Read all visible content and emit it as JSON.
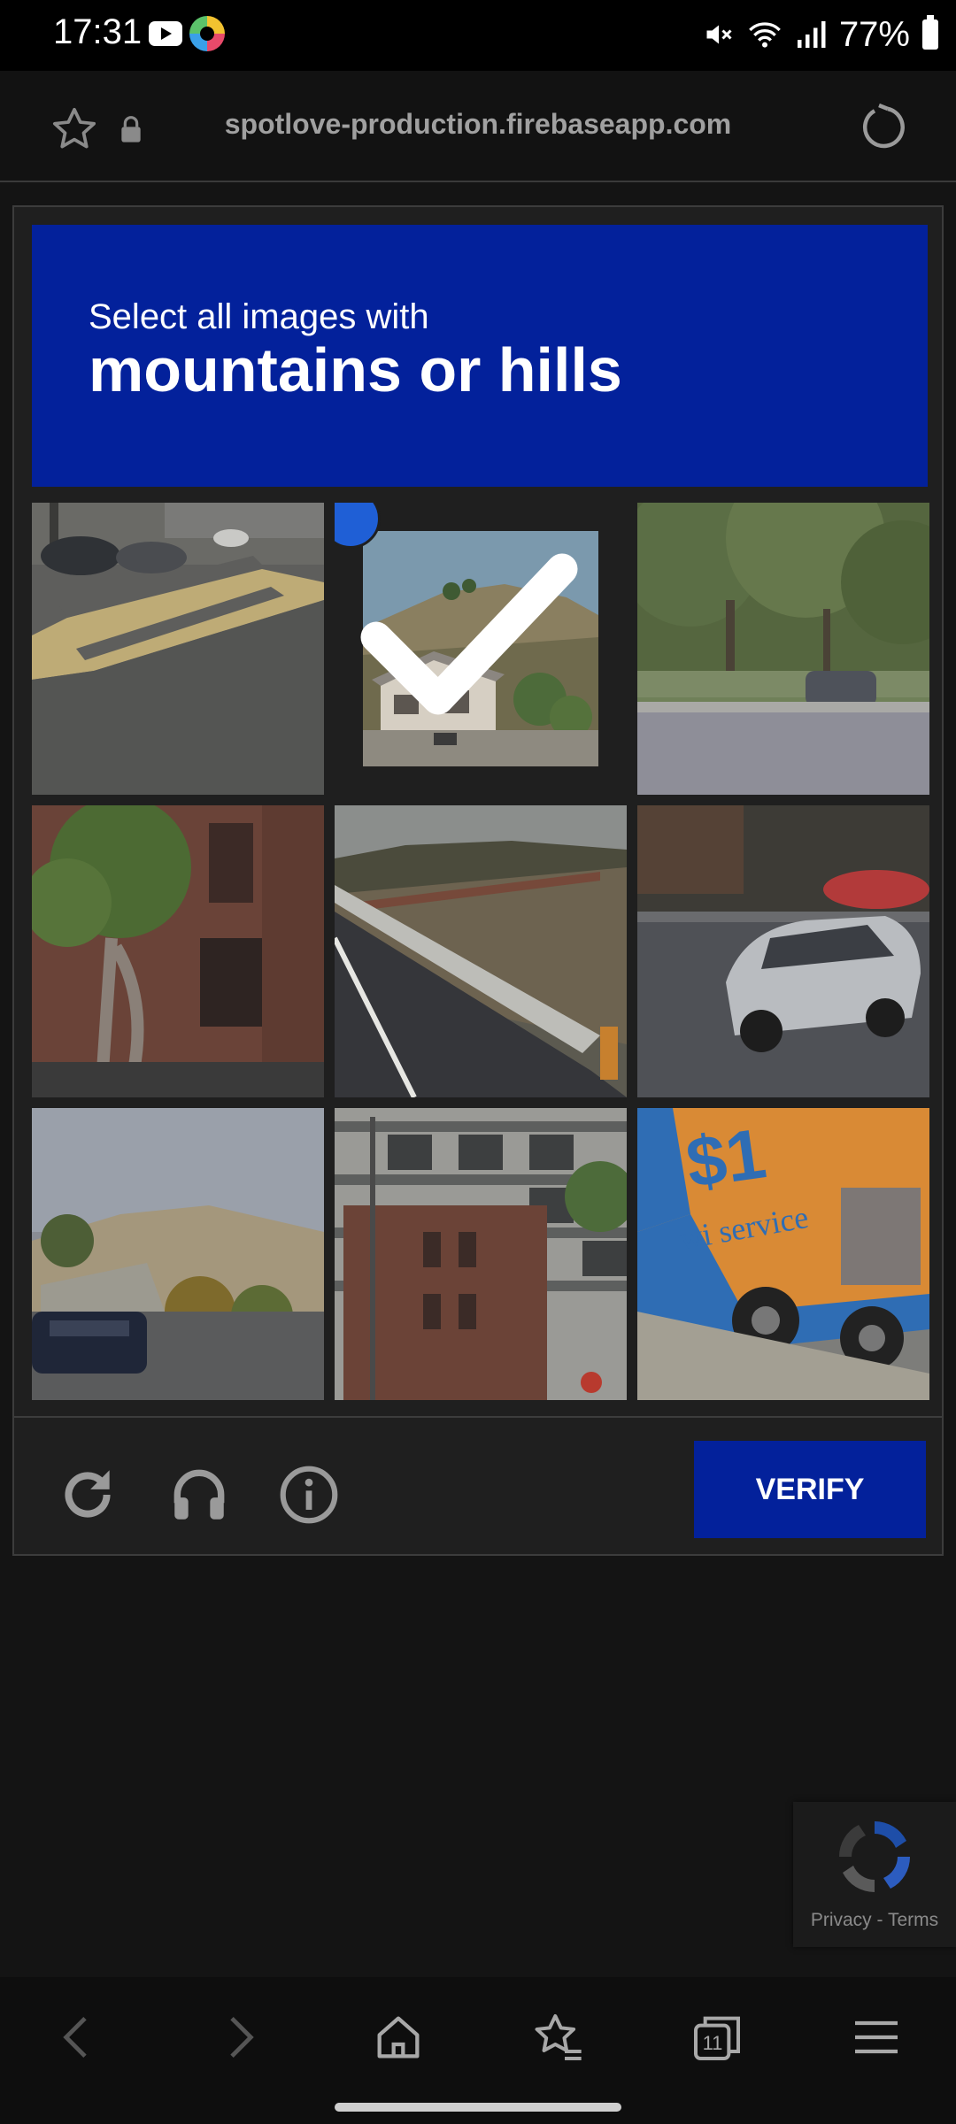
{
  "status_bar": {
    "time": "17:31",
    "battery": "77%",
    "icons": [
      "youtube-icon",
      "app-icon",
      "mute-icon",
      "wifi-icon",
      "signal-icon",
      "battery-icon"
    ]
  },
  "browser": {
    "url": "spotlove-production.firebaseapp.com",
    "icons": [
      "star-icon",
      "lock-icon",
      "reload-icon"
    ]
  },
  "captcha": {
    "instruction_prefix": "Select all images with",
    "target": "mountains or hills",
    "header_color": "#03219b",
    "tiles": [
      {
        "index": 1,
        "selected": false
      },
      {
        "index": 2,
        "selected": true
      },
      {
        "index": 3,
        "selected": false
      },
      {
        "index": 4,
        "selected": false
      },
      {
        "index": 5,
        "selected": false
      },
      {
        "index": 6,
        "selected": false
      },
      {
        "index": 7,
        "selected": false
      },
      {
        "index": 8,
        "selected": false
      },
      {
        "index": 9,
        "selected": false
      }
    ],
    "footer_icons": [
      "refresh-icon",
      "headphones-icon",
      "info-icon"
    ],
    "verify_label": "VERIFY"
  },
  "recaptcha_badge": {
    "privacy": "Privacy",
    "separator": "-",
    "terms": "Terms"
  },
  "bottom_nav": {
    "icons": [
      "back-icon",
      "forward-icon",
      "home-icon",
      "bookmarks-icon",
      "tabs-icon",
      "menu-icon"
    ],
    "tab_count": "11"
  }
}
